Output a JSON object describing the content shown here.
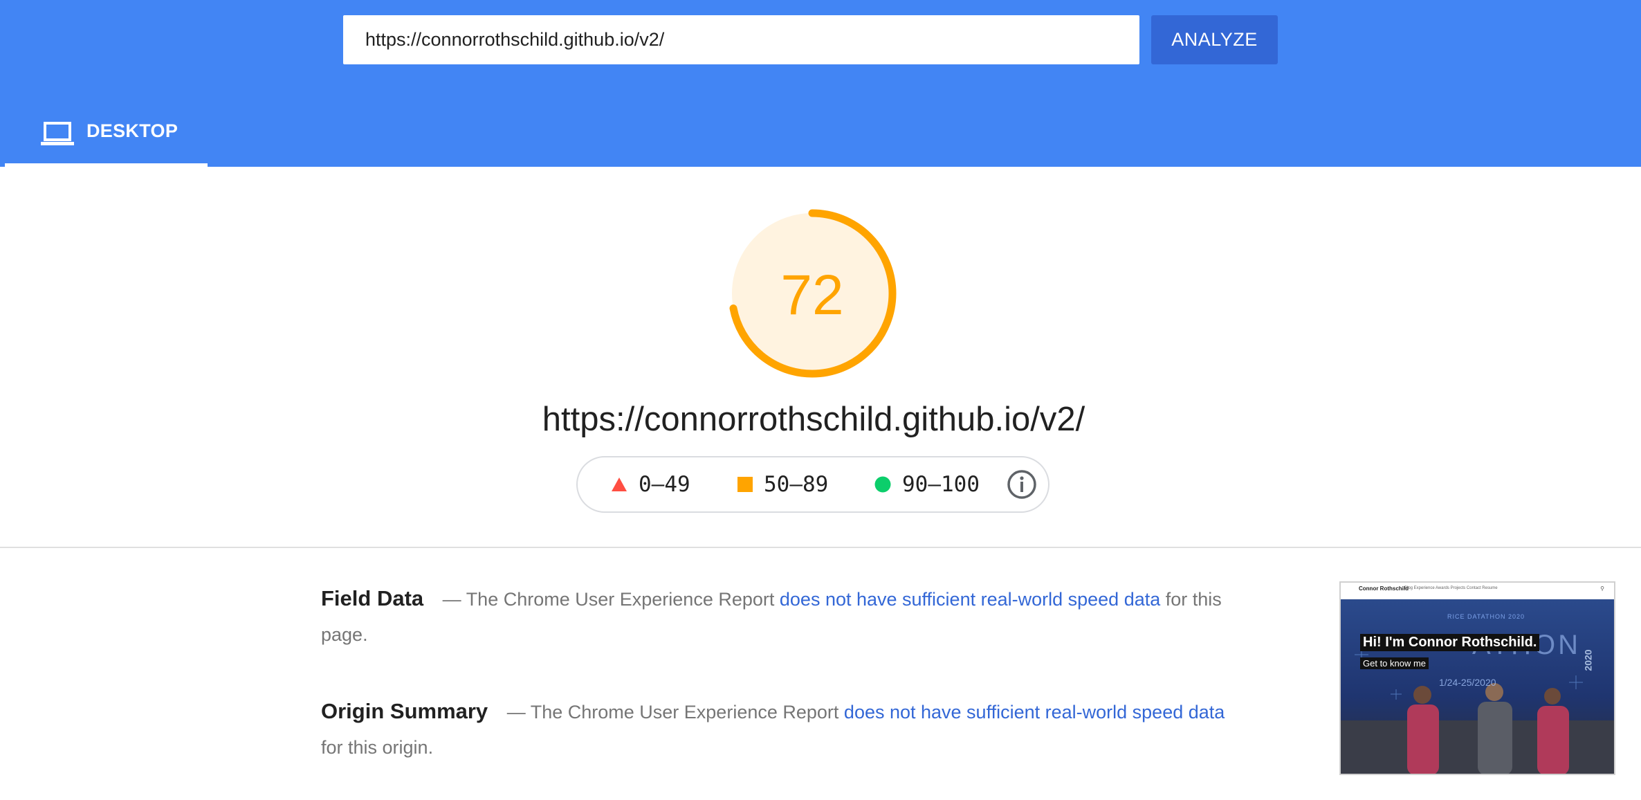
{
  "search": {
    "url_value": "https://connorrothschild.github.io/v2/",
    "analyze_label": "ANALYZE"
  },
  "tabs": [
    {
      "label": "DESKTOP",
      "icon": "laptop-icon",
      "selected": true
    }
  ],
  "score": {
    "value": "72",
    "fraction": 0.72,
    "color": "#ffa400",
    "background": "#fff3e0"
  },
  "report_url": "https://connorrothschild.github.io/v2/",
  "legend": {
    "fail": {
      "range": "0–49",
      "icon": "triangle-icon",
      "color": "#ff4e42"
    },
    "average": {
      "range": "50–89",
      "icon": "square-icon",
      "color": "#ffa400"
    },
    "pass": {
      "range": "90–100",
      "icon": "circle-icon",
      "color": "#0cce6b"
    },
    "info_icon": "info-icon"
  },
  "field_data": {
    "title": "Field Data",
    "dash": "—",
    "text_before": "The Chrome User Experience Report",
    "link_text": "does not have sufficient real-world speed data",
    "text_after": "for this page."
  },
  "origin_summary": {
    "title": "Origin Summary",
    "dash": "—",
    "text_before": "The Chrome User Experience Report",
    "link_text": "does not have sufficient real-world speed data",
    "text_after": "for this origin."
  },
  "thumbnail": {
    "nav_brand": "Connor Rothschild",
    "nav_links": "Blog  Experience  Awards  Projects  Contact  Resume",
    "heading": "Hi! I'm Connor Rothschild.",
    "subheading": "Get to know me",
    "banner_text": "RICE DATATHON 2020",
    "big_text": "ATHON",
    "date_text": "1/24-25/2020",
    "year_text": "2020"
  },
  "colors": {
    "header_blue": "#4285f4",
    "button_blue": "#3367d6",
    "link_blue": "#3367d6"
  }
}
